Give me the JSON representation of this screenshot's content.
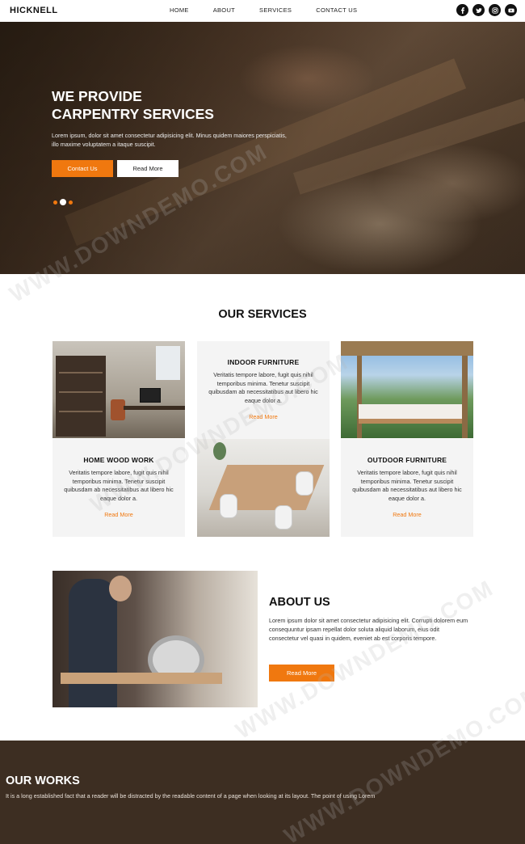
{
  "header": {
    "logo": "HICKNELL",
    "nav": [
      "HOME",
      "ABOUT",
      "SERVICES",
      "CONTACT US"
    ],
    "social": [
      "facebook-icon",
      "twitter-icon",
      "instagram-icon",
      "youtube-icon"
    ]
  },
  "hero": {
    "title_line1": "WE PROVIDE",
    "title_line2": "CARPENTRY SERVICES",
    "text": "Lorem ipsum, dolor sit amet consectetur adipisicing elit. Minus quidem maiores perspiciatis, illo maxime voluptatem a itaque suscipit.",
    "primary_button": "Contact Us",
    "secondary_button": "Read More",
    "slide_dots": 3,
    "active_slide": 2
  },
  "services": {
    "title": "OUR SERVICES",
    "cards": [
      {
        "title": "INDOOR FURNITURE",
        "text": "Veritatis tempore labore, fugit quis nihil temporibus minima. Tenetur suscipit quibusdam ab necessitatibus aut libero hic eaque dolor a.",
        "link": "Read More"
      },
      {
        "title": "HOME WOOD WORK",
        "text": "Veritatis tempore labore, fugit quis nihil temporibus minima. Tenetur suscipit quibusdam ab necessitatibus aut libero hic eaque dolor a.",
        "link": "Read More"
      },
      {
        "title": "OUTDOOR FURNITURE",
        "text": "Veritatis tempore labore, fugit quis nihil temporibus minima. Tenetur suscipit quibusdam ab necessitatibus aut libero hic eaque dolor a.",
        "link": "Read More"
      }
    ]
  },
  "about": {
    "title": "ABOUT US",
    "text": "Lorem ipsum dolor sit amet consectetur adipisicing elit. Corrupti dolorem eum consequuntur ipsam repellat dolor soluta aliquid laborum, eius odit consectetur vel quasi in quidem, eveniet ab est corporis tempore.",
    "button": "Read More"
  },
  "works": {
    "title": "OUR WORKS",
    "text": "It is a long established fact that a reader will be distracted by the readable content of a page when looking at its layout. The point of using Lorem"
  },
  "watermark": "WWW.DOWNDEMO.COM",
  "colors": {
    "accent": "#f0780f",
    "dark_brown": "#3d2e22",
    "card_bg": "#f4f4f4"
  }
}
